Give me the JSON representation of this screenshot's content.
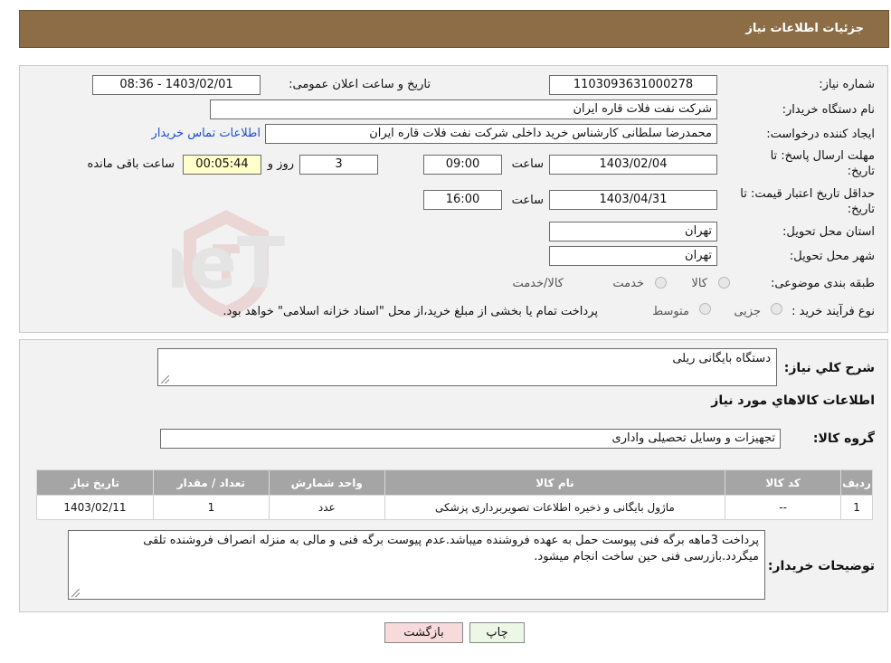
{
  "header": {
    "title": "جزئیات اطلاعات نیاز"
  },
  "form": {
    "need_number_label": "شماره نیاز:",
    "need_number": "1103093631000278",
    "announce_label": "تاریخ و ساعت اعلان عمومی:",
    "announce_value": "1403/02/01 - 08:36",
    "buyer_org_label": "نام دستگاه خریدار:",
    "buyer_org": "شرکت نفت فلات قاره ایران",
    "creator_label": "ایجاد کننده درخواست:",
    "creator": "محمدرضا سلطانی کارشناس خرید داخلی شرکت نفت فلات قاره ایران",
    "contact_link": "اطلاعات تماس خریدار",
    "deadline_label_1": "مهلت ارسال پاسخ: تا",
    "deadline_label_2": "تاریخ:",
    "deadline_date": "1403/02/04",
    "time_label": "ساعت",
    "deadline_time": "09:00",
    "days_value": "3",
    "days_label": "روز و",
    "remaining_time": "00:05:44",
    "remaining_label": "ساعت باقی مانده",
    "validity_label_1": "حداقل تاریخ اعتبار قیمت: تا",
    "validity_label_2": "تاریخ:",
    "validity_date": "1403/04/31",
    "validity_time": "16:00",
    "province_label": "استان محل تحویل:",
    "province": "تهران",
    "city_label": "شهر محل تحویل:",
    "city": "تهران",
    "category_label": "طبقه بندی موضوعی:",
    "category_options": [
      "کالا",
      "خدمت",
      "کالا/خدمت"
    ],
    "process_label": "نوع فرآیند خرید :",
    "process_options": [
      "جزیی",
      "متوسط"
    ],
    "process_note": "پرداخت تمام یا بخشی از مبلغ خرید،از محل \"اسناد خزانه اسلامی\" خواهد بود."
  },
  "details": {
    "summary_label": "شرح کلي نياز:",
    "summary": "دستگاه بایگانی ریلی",
    "goods_info_title": "اطلاعات کالاهاي مورد نياز",
    "group_label": "گروه کالا:",
    "group": "تجهیزات و وسایل تحصیلی واداری",
    "table": {
      "headers": [
        "ردیف",
        "کد کالا",
        "نام کالا",
        "واحد شمارش",
        "تعداد / مقدار",
        "تاریخ نیاز"
      ],
      "rows": [
        [
          "1",
          "--",
          "ماژول بایگانی و ذخیره اطلاعات تصویربرداری پزشکی",
          "عدد",
          "1",
          "1403/02/11"
        ]
      ]
    },
    "buyer_notes_label": "توضیحات خریدار:",
    "buyer_notes": "پرداخت 3ماهه برگه فنی پیوست حمل به عهده فروشنده میباشد.عدم پیوست برگه فنی و مالی به منزله انصراف فروشنده تلقی میگردد.بازرسی فنی حین ساخت انجام میشود."
  },
  "buttons": {
    "print": "چاپ",
    "back": "بازگشت"
  },
  "watermark": {
    "text": "AriaTender.neT"
  },
  "colors": {
    "header_bg": "#8c6d46",
    "link": "#1a4fd1",
    "table_header": "#a5a5a5",
    "back_button": "#f7dada"
  }
}
